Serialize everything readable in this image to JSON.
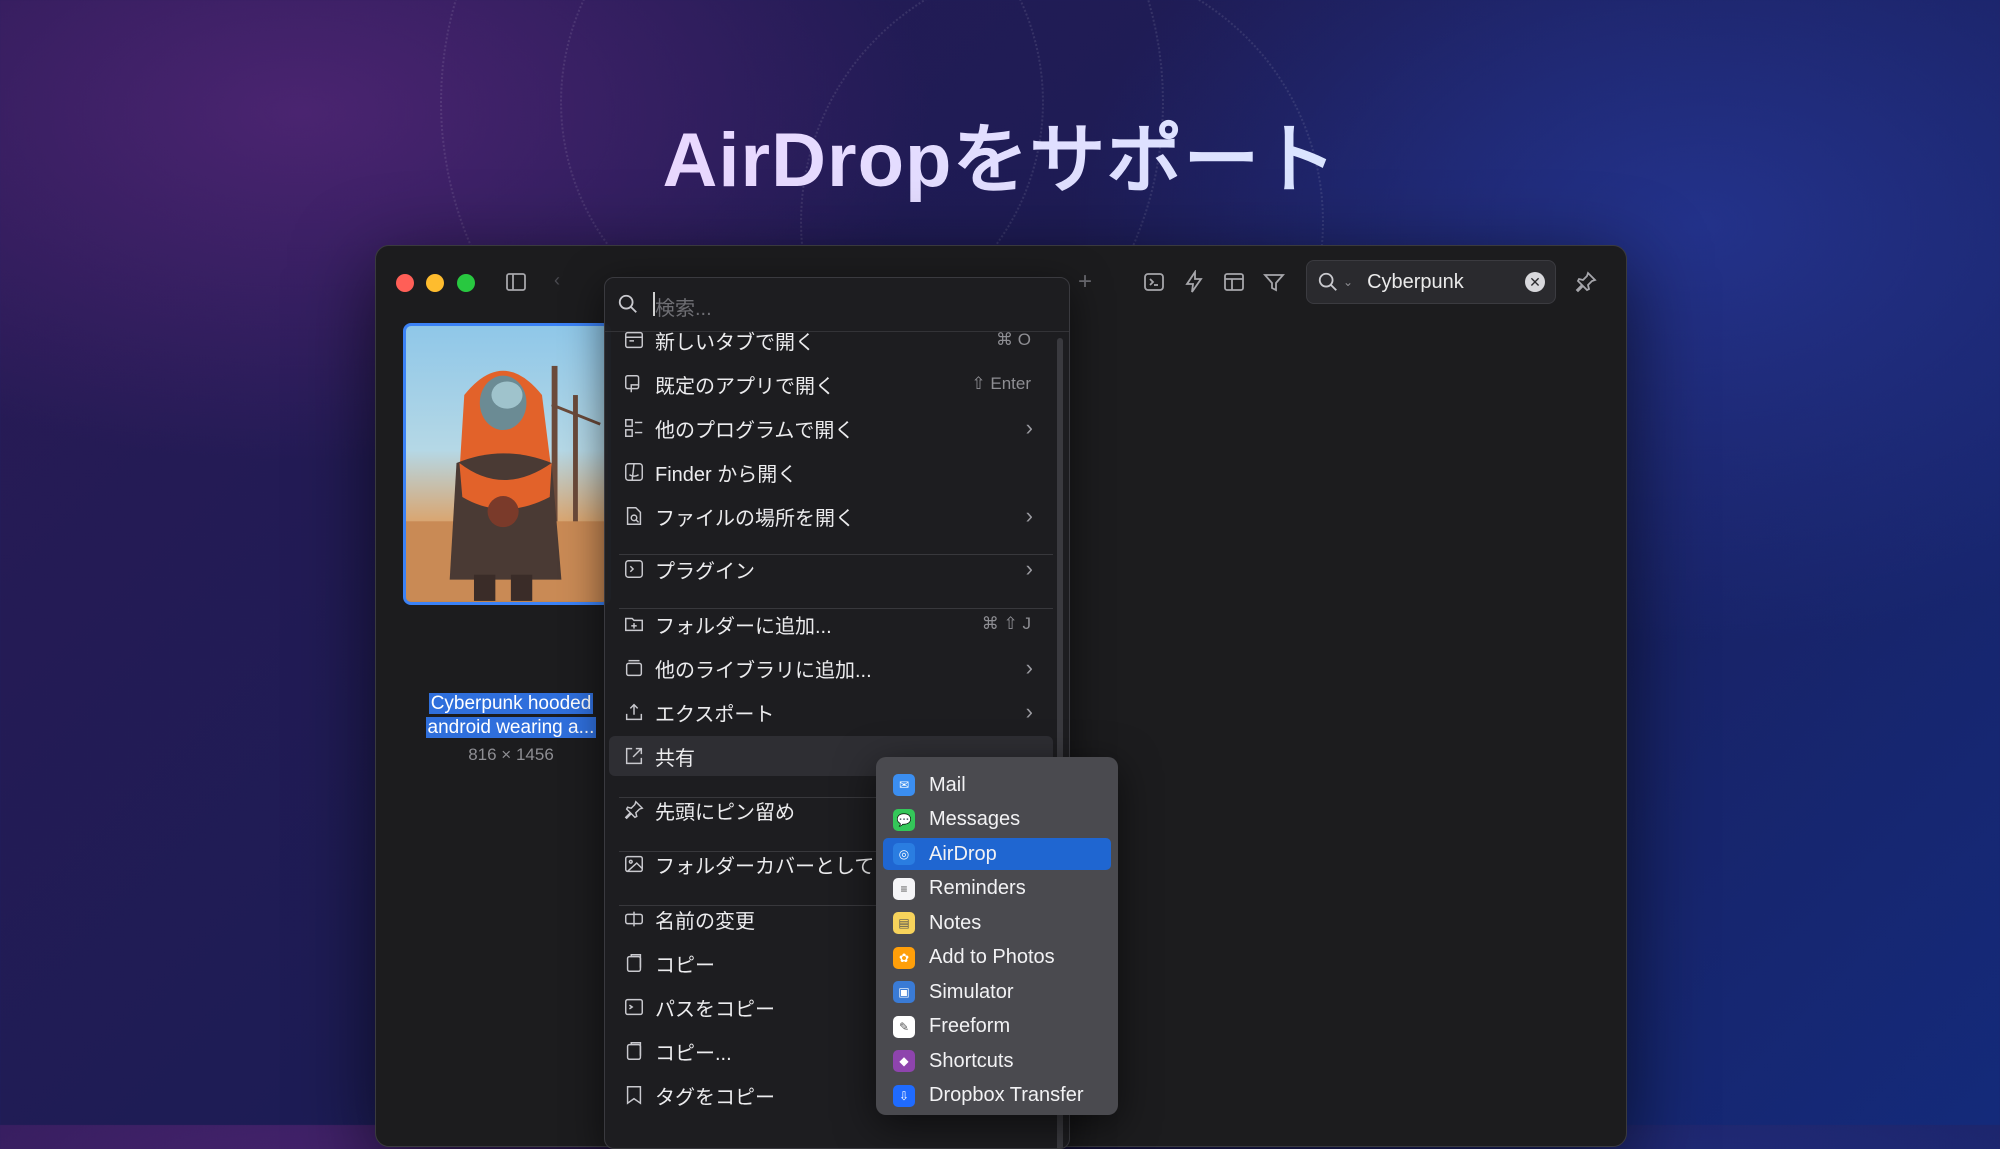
{
  "hero": {
    "title": "AirDropをサポート"
  },
  "window": {
    "toolbar": {
      "search_query": "Cyberpunk"
    },
    "item": {
      "caption_line1": "Cyberpunk hooded",
      "caption_line2": "android wearing a...",
      "dimensions": "816 × 1456"
    }
  },
  "context_menu": {
    "search_placeholder": "検索...",
    "items": [
      {
        "label": "新しいタブで開く",
        "shortcut": "⌘ O",
        "submenu": false,
        "icon": "new-tab-icon"
      },
      {
        "label": "既定のアプリで開く",
        "shortcut": "⇧ Enter",
        "submenu": false,
        "icon": "open-app-icon"
      },
      {
        "label": "他のプログラムで開く",
        "shortcut": "",
        "submenu": true,
        "icon": "grid-icon"
      },
      {
        "label": "Finder から開く",
        "shortcut": "",
        "submenu": false,
        "icon": "finder-icon"
      },
      {
        "label": "ファイルの場所を開く",
        "shortcut": "",
        "submenu": true,
        "icon": "file-search-icon"
      },
      {
        "label": "プラグイン",
        "shortcut": "",
        "submenu": true,
        "icon": "plugin-icon"
      },
      {
        "label": "フォルダーに追加...",
        "shortcut": "⌘ ⇧ J",
        "submenu": false,
        "icon": "folder-add-icon"
      },
      {
        "label": "他のライブラリに追加...",
        "shortcut": "",
        "submenu": true,
        "icon": "library-icon"
      },
      {
        "label": "エクスポート",
        "shortcut": "",
        "submenu": true,
        "icon": "export-icon"
      },
      {
        "label": "共有",
        "shortcut": "",
        "submenu": false,
        "icon": "share-icon"
      },
      {
        "label": "先頭にピン留め",
        "shortcut": "",
        "submenu": false,
        "icon": "pin-icon"
      },
      {
        "label": "フォルダーカバーとして",
        "shortcut": "",
        "submenu": false,
        "icon": "image-icon"
      },
      {
        "label": "名前の変更",
        "shortcut": "",
        "submenu": false,
        "icon": "rename-icon"
      },
      {
        "label": "コピー",
        "shortcut": "",
        "submenu": false,
        "icon": "copy-icon"
      },
      {
        "label": "パスをコピー",
        "shortcut": "",
        "submenu": false,
        "icon": "path-icon"
      },
      {
        "label": "コピー...",
        "shortcut": "",
        "submenu": false,
        "icon": "copy-icon"
      },
      {
        "label": "タグをコピー",
        "shortcut": "",
        "submenu": false,
        "icon": "tag-icon"
      }
    ]
  },
  "share_submenu": {
    "items": [
      {
        "label": "Mail",
        "color": "#3b8ef0",
        "glyph": "✉"
      },
      {
        "label": "Messages",
        "color": "#34c759",
        "glyph": "💬"
      },
      {
        "label": "AirDrop",
        "color": "#2a7de1",
        "glyph": "◎",
        "selected": true
      },
      {
        "label": "Reminders",
        "color": "#f5f5f7",
        "glyph": "≡"
      },
      {
        "label": "Notes",
        "color": "#f7d35b",
        "glyph": "▤"
      },
      {
        "label": "Add to Photos",
        "color": "#ff9f0a",
        "glyph": "✿"
      },
      {
        "label": "Simulator",
        "color": "#3a7bd5",
        "glyph": "▣"
      },
      {
        "label": "Freeform",
        "color": "#ffffff",
        "glyph": "✎"
      },
      {
        "label": "Shortcuts",
        "color": "#8e44ad",
        "glyph": "◆"
      },
      {
        "label": "Dropbox Transfer",
        "color": "#1f6bff",
        "glyph": "⇩"
      }
    ]
  }
}
